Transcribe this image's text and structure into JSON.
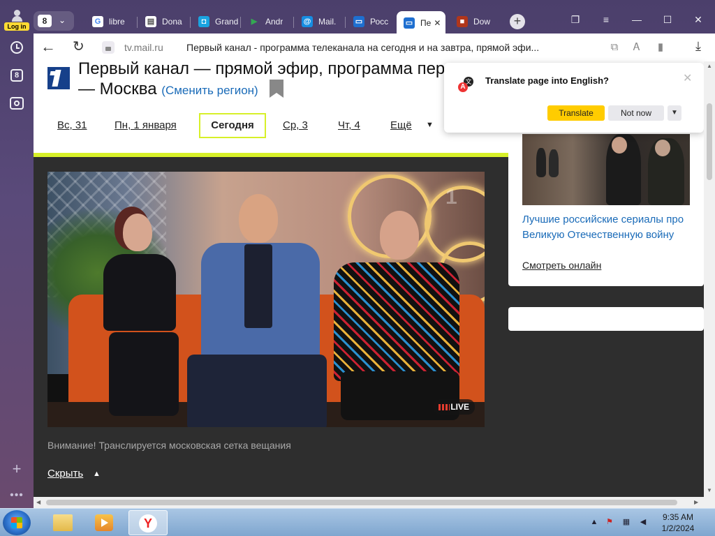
{
  "sidebar": {
    "login_label": "Log in",
    "counter": "8",
    "icons": [
      "user-icon",
      "history-clock-icon",
      "tabs-counter-icon",
      "screenshot-camera-icon",
      "add-icon",
      "more-dots-icon"
    ]
  },
  "tabs": {
    "count": "8",
    "items": [
      {
        "title": "libre",
        "favicon": "google-icon",
        "color": "#ffffff",
        "letter": "G"
      },
      {
        "title": "Dona",
        "favicon": "document-icon",
        "color": "#ffffff",
        "letter": "▤"
      },
      {
        "title": "Grand",
        "favicon": "grand-icon",
        "color": "#1aa3e0",
        "letter": "◘"
      },
      {
        "title": "Andr",
        "favicon": "play-store-icon",
        "color": "#34a853",
        "letter": "▶"
      },
      {
        "title": "Mail.",
        "favicon": "mail-at-icon",
        "color": "#168de2",
        "letter": "@"
      },
      {
        "title": "Росс",
        "favicon": "tv-icon",
        "color": "#1e6fd0",
        "letter": "▭"
      },
      {
        "title": "Пе",
        "favicon": "tv-icon",
        "color": "#1e6fd0",
        "letter": "▭",
        "active": true
      },
      {
        "title": "Dow",
        "favicon": "download-site-icon",
        "color": "#b0361b",
        "letter": "■"
      }
    ]
  },
  "address": {
    "domain": "tv.mail.ru",
    "title": "Первый канал - программа телеканала на сегодня и на завтра, прямой эфи..."
  },
  "page": {
    "channel_title": "Первый канал — прямой эфир, программа передач — Москва",
    "change_region": "(Сменить регион)",
    "days": [
      "Вс, 31",
      "Пн, 1 января",
      "Сегодня",
      "Ср, 3",
      "Чт, 4",
      "Ещё"
    ],
    "live_label": "LIVE",
    "notice": "Внимание! Транслируется московская сетка вещания",
    "hide_label": "Скрыть"
  },
  "ad": {
    "title": "Лучшие российские сериалы про Великую Отечественную войну",
    "link": "Смотреть онлайн"
  },
  "translate": {
    "question": "Translate page into English?",
    "translate_button": "Translate",
    "not_now_button": "Not now"
  },
  "taskbar": {
    "time": "9:35 AM",
    "date": "1/2/2024"
  },
  "colors": {
    "accent_yellow": "#d7f029",
    "link_blue": "#1a6bb8",
    "translate_yellow": "#ffcc00"
  }
}
